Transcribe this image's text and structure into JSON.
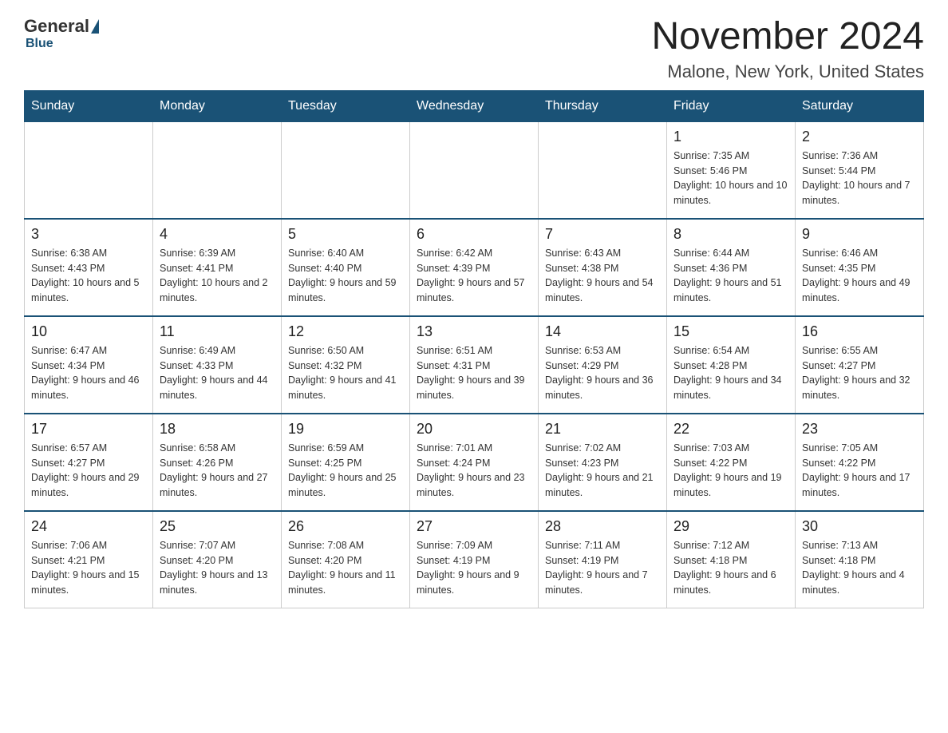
{
  "header": {
    "logo": {
      "general": "General",
      "blue": "Blue"
    },
    "title": "November 2024",
    "location": "Malone, New York, United States"
  },
  "days_of_week": [
    "Sunday",
    "Monday",
    "Tuesday",
    "Wednesday",
    "Thursday",
    "Friday",
    "Saturday"
  ],
  "weeks": [
    [
      {
        "day": "",
        "sunrise": "",
        "sunset": "",
        "daylight": ""
      },
      {
        "day": "",
        "sunrise": "",
        "sunset": "",
        "daylight": ""
      },
      {
        "day": "",
        "sunrise": "",
        "sunset": "",
        "daylight": ""
      },
      {
        "day": "",
        "sunrise": "",
        "sunset": "",
        "daylight": ""
      },
      {
        "day": "",
        "sunrise": "",
        "sunset": "",
        "daylight": ""
      },
      {
        "day": "1",
        "sunrise": "Sunrise: 7:35 AM",
        "sunset": "Sunset: 5:46 PM",
        "daylight": "Daylight: 10 hours and 10 minutes."
      },
      {
        "day": "2",
        "sunrise": "Sunrise: 7:36 AM",
        "sunset": "Sunset: 5:44 PM",
        "daylight": "Daylight: 10 hours and 7 minutes."
      }
    ],
    [
      {
        "day": "3",
        "sunrise": "Sunrise: 6:38 AM",
        "sunset": "Sunset: 4:43 PM",
        "daylight": "Daylight: 10 hours and 5 minutes."
      },
      {
        "day": "4",
        "sunrise": "Sunrise: 6:39 AM",
        "sunset": "Sunset: 4:41 PM",
        "daylight": "Daylight: 10 hours and 2 minutes."
      },
      {
        "day": "5",
        "sunrise": "Sunrise: 6:40 AM",
        "sunset": "Sunset: 4:40 PM",
        "daylight": "Daylight: 9 hours and 59 minutes."
      },
      {
        "day": "6",
        "sunrise": "Sunrise: 6:42 AM",
        "sunset": "Sunset: 4:39 PM",
        "daylight": "Daylight: 9 hours and 57 minutes."
      },
      {
        "day": "7",
        "sunrise": "Sunrise: 6:43 AM",
        "sunset": "Sunset: 4:38 PM",
        "daylight": "Daylight: 9 hours and 54 minutes."
      },
      {
        "day": "8",
        "sunrise": "Sunrise: 6:44 AM",
        "sunset": "Sunset: 4:36 PM",
        "daylight": "Daylight: 9 hours and 51 minutes."
      },
      {
        "day": "9",
        "sunrise": "Sunrise: 6:46 AM",
        "sunset": "Sunset: 4:35 PM",
        "daylight": "Daylight: 9 hours and 49 minutes."
      }
    ],
    [
      {
        "day": "10",
        "sunrise": "Sunrise: 6:47 AM",
        "sunset": "Sunset: 4:34 PM",
        "daylight": "Daylight: 9 hours and 46 minutes."
      },
      {
        "day": "11",
        "sunrise": "Sunrise: 6:49 AM",
        "sunset": "Sunset: 4:33 PM",
        "daylight": "Daylight: 9 hours and 44 minutes."
      },
      {
        "day": "12",
        "sunrise": "Sunrise: 6:50 AM",
        "sunset": "Sunset: 4:32 PM",
        "daylight": "Daylight: 9 hours and 41 minutes."
      },
      {
        "day": "13",
        "sunrise": "Sunrise: 6:51 AM",
        "sunset": "Sunset: 4:31 PM",
        "daylight": "Daylight: 9 hours and 39 minutes."
      },
      {
        "day": "14",
        "sunrise": "Sunrise: 6:53 AM",
        "sunset": "Sunset: 4:29 PM",
        "daylight": "Daylight: 9 hours and 36 minutes."
      },
      {
        "day": "15",
        "sunrise": "Sunrise: 6:54 AM",
        "sunset": "Sunset: 4:28 PM",
        "daylight": "Daylight: 9 hours and 34 minutes."
      },
      {
        "day": "16",
        "sunrise": "Sunrise: 6:55 AM",
        "sunset": "Sunset: 4:27 PM",
        "daylight": "Daylight: 9 hours and 32 minutes."
      }
    ],
    [
      {
        "day": "17",
        "sunrise": "Sunrise: 6:57 AM",
        "sunset": "Sunset: 4:27 PM",
        "daylight": "Daylight: 9 hours and 29 minutes."
      },
      {
        "day": "18",
        "sunrise": "Sunrise: 6:58 AM",
        "sunset": "Sunset: 4:26 PM",
        "daylight": "Daylight: 9 hours and 27 minutes."
      },
      {
        "day": "19",
        "sunrise": "Sunrise: 6:59 AM",
        "sunset": "Sunset: 4:25 PM",
        "daylight": "Daylight: 9 hours and 25 minutes."
      },
      {
        "day": "20",
        "sunrise": "Sunrise: 7:01 AM",
        "sunset": "Sunset: 4:24 PM",
        "daylight": "Daylight: 9 hours and 23 minutes."
      },
      {
        "day": "21",
        "sunrise": "Sunrise: 7:02 AM",
        "sunset": "Sunset: 4:23 PM",
        "daylight": "Daylight: 9 hours and 21 minutes."
      },
      {
        "day": "22",
        "sunrise": "Sunrise: 7:03 AM",
        "sunset": "Sunset: 4:22 PM",
        "daylight": "Daylight: 9 hours and 19 minutes."
      },
      {
        "day": "23",
        "sunrise": "Sunrise: 7:05 AM",
        "sunset": "Sunset: 4:22 PM",
        "daylight": "Daylight: 9 hours and 17 minutes."
      }
    ],
    [
      {
        "day": "24",
        "sunrise": "Sunrise: 7:06 AM",
        "sunset": "Sunset: 4:21 PM",
        "daylight": "Daylight: 9 hours and 15 minutes."
      },
      {
        "day": "25",
        "sunrise": "Sunrise: 7:07 AM",
        "sunset": "Sunset: 4:20 PM",
        "daylight": "Daylight: 9 hours and 13 minutes."
      },
      {
        "day": "26",
        "sunrise": "Sunrise: 7:08 AM",
        "sunset": "Sunset: 4:20 PM",
        "daylight": "Daylight: 9 hours and 11 minutes."
      },
      {
        "day": "27",
        "sunrise": "Sunrise: 7:09 AM",
        "sunset": "Sunset: 4:19 PM",
        "daylight": "Daylight: 9 hours and 9 minutes."
      },
      {
        "day": "28",
        "sunrise": "Sunrise: 7:11 AM",
        "sunset": "Sunset: 4:19 PM",
        "daylight": "Daylight: 9 hours and 7 minutes."
      },
      {
        "day": "29",
        "sunrise": "Sunrise: 7:12 AM",
        "sunset": "Sunset: 4:18 PM",
        "daylight": "Daylight: 9 hours and 6 minutes."
      },
      {
        "day": "30",
        "sunrise": "Sunrise: 7:13 AM",
        "sunset": "Sunset: 4:18 PM",
        "daylight": "Daylight: 9 hours and 4 minutes."
      }
    ]
  ]
}
